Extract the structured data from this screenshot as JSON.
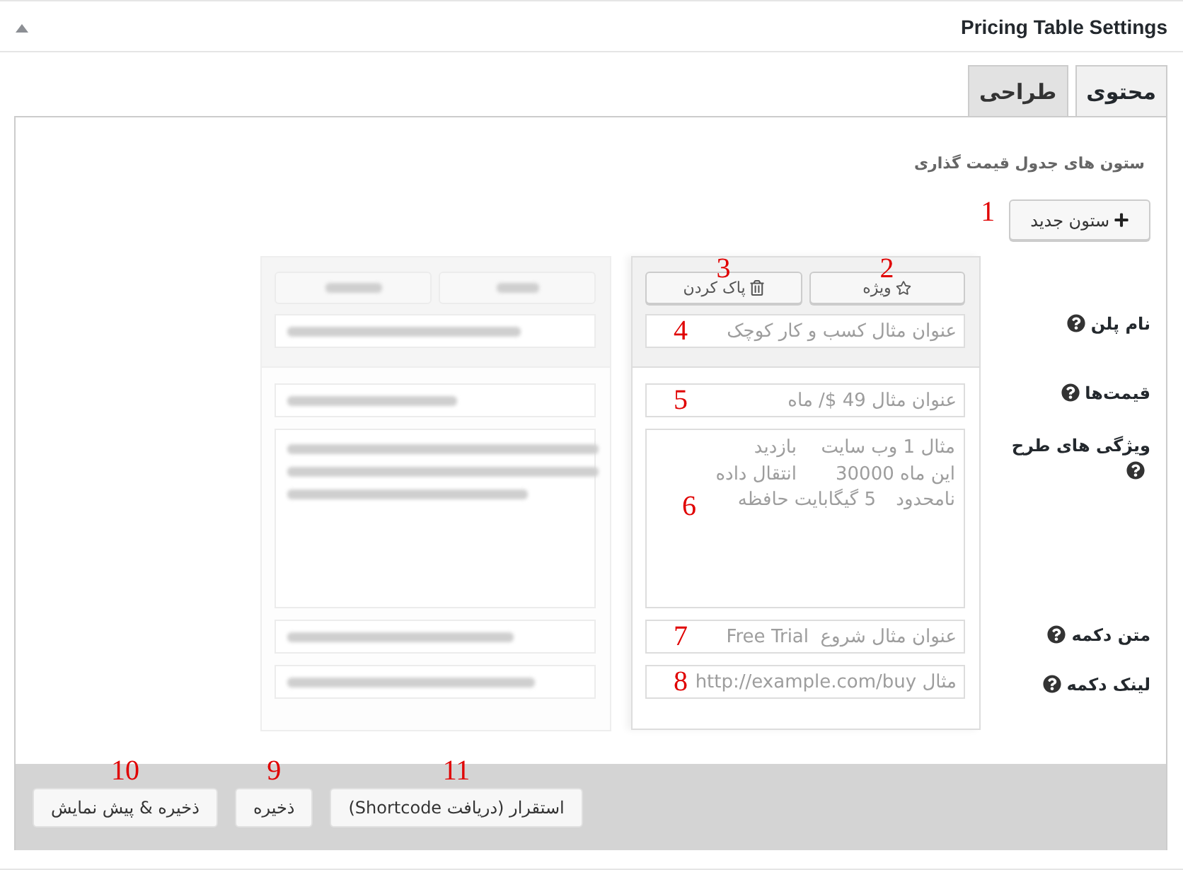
{
  "panel": {
    "title": "Pricing Table Settings"
  },
  "tabs": [
    {
      "label": "محتوی",
      "selected": true
    },
    {
      "label": "طراحی",
      "selected": false
    }
  ],
  "section_title": "ستون های جدول قیمت گذاری",
  "add_column_button": {
    "label": "ستون جدید",
    "annotation": "1"
  },
  "field_labels": [
    {
      "label": "نام پلن"
    },
    {
      "label": "قیمت‌ها"
    },
    {
      "label": "ویژگی های طرح"
    },
    {
      "label": "متن دکمه"
    },
    {
      "label": "لینک دکمه"
    }
  ],
  "columns": [
    {
      "kind": "editor",
      "header": {
        "buttons": [
          {
            "kind": "featured",
            "label": "ویژه",
            "annotation": "2"
          },
          {
            "kind": "delete",
            "label": "پاک کردن",
            "annotation": "3"
          }
        ],
        "fields": [
          {
            "kind": "input",
            "placeholder": "عنوان مثال کسب و کار کوچک",
            "annotation": "4"
          }
        ]
      },
      "body": {
        "fields": [
          {
            "kind": "input",
            "placeholder": "عنوان مثال 49 $/ ماه",
            "annotation": "5"
          },
          {
            "kind": "textarea",
            "placeholder": "مثال 1 وب سایت\tبازدید\nاین ماه 30000\tانتقال داده\nنامحدود\t5 گیگابایت حافظه",
            "annotation": "6"
          },
          {
            "kind": "input",
            "placeholder": "عنوان مثال شروع  Free Trial",
            "annotation": "7"
          },
          {
            "kind": "input",
            "placeholder": "مثال http://example.com/buy",
            "annotation": "8"
          }
        ]
      }
    },
    {
      "kind": "blurred"
    }
  ],
  "footer_buttons": [
    {
      "label": "استقرار (دریافت Shortcode)",
      "annotation": "11"
    },
    {
      "label": "ذخیره",
      "annotation": "9"
    },
    {
      "label": "ذخیره & پیش نمایش",
      "annotation": "10"
    }
  ]
}
